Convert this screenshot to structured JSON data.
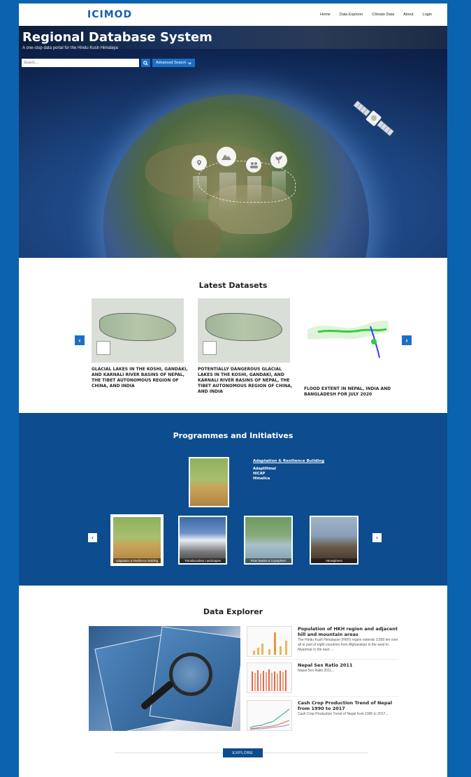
{
  "nav": {
    "logo": "ICIMOD",
    "links": [
      "Home",
      "Data Explorer",
      "Climate Data",
      "About",
      "Login"
    ]
  },
  "hero": {
    "title": "Regional Database System",
    "subtitle": "A one-stop data portal for the Hindu Kush Himalaya",
    "search_placeholder": "Search...",
    "advanced_label": "Advanced Search"
  },
  "latest": {
    "title": "Latest Datasets",
    "cards": [
      {
        "title": "GLACIAL LAKES IN THE KOSHI, GANDAKI, AND KARNALI RIVER BASINS OF NEPAL, THE TIBET AUTONOMOUS REGION OF CHINA, AND INDIA"
      },
      {
        "title": "POTENTIALLY DANGEROUS GLACIAL LAKES IN THE KOSHI, GANDAKI, AND KARNALI RIVER BASINS OF NEPAL, THE TIBET AUTONOMOUS REGION OF CHINA, AND INDIA"
      },
      {
        "title": "FLOOD EXTENT IN NEPAL, INDIA AND BANGLADESH FOR JULY 2020"
      }
    ]
  },
  "programmes": {
    "title": "Programmes and Initiatives",
    "main_link": "Adaptation & Resilience Building",
    "sub_links": [
      "AdaptHimal",
      "HICAP",
      "Himalica"
    ],
    "thumbs": [
      {
        "caption": "Adaptation & Resilience Building"
      },
      {
        "caption": "Transboundary Landscapes"
      },
      {
        "caption": "River Basins & Cryosphere"
      },
      {
        "caption": "AtmosphereI"
      }
    ]
  },
  "explorer": {
    "title": "Data Explorer",
    "items": [
      {
        "title": "Population of HKH region and adjacent hill and mountain areas",
        "desc": "The Hindu Kush Himalayan (HKH) region extends 3,500 km over all or part of eight countries from Afghanistan in the west to Myanmar in the east. ..."
      },
      {
        "title": "Nepal Sex Ratio 2011",
        "desc": "Nepal Sex Ratio 2011..."
      },
      {
        "title": "Cash Crop Production Trend of Nepal from 1990 to 2017",
        "desc": "Cash Crop Production Trend of Nepal from 1990 to 2017..."
      }
    ],
    "button": "EXPLORE"
  }
}
